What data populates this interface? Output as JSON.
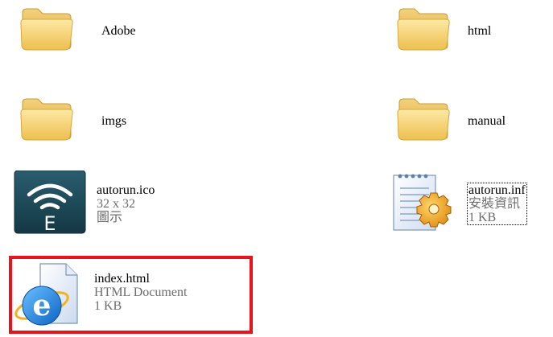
{
  "items": [
    {
      "name": "Adobe",
      "type": "folder",
      "icon": "folder-icon"
    },
    {
      "name": "html",
      "type": "folder",
      "icon": "folder-icon"
    },
    {
      "name": "imgs",
      "type": "folder",
      "icon": "folder-icon"
    },
    {
      "name": "manual",
      "type": "folder",
      "icon": "folder-icon"
    },
    {
      "name": "autorun.ico",
      "type": "file",
      "icon": "autorun-e-icon",
      "line2": "32 x 32",
      "line3": "圖示"
    },
    {
      "name": "autorun.inf",
      "type": "file",
      "icon": "settings-document-icon",
      "line2": "安裝資訊",
      "line3": "1 KB"
    },
    {
      "name": "index.html",
      "type": "file",
      "icon": "internet-explorer-document-icon",
      "line2": "HTML Document",
      "line3": "1 KB"
    }
  ],
  "colors": {
    "highlight_box": "#e8141b",
    "secondary_text": "#6d6d6d",
    "folder_body": "#f6d77f"
  }
}
